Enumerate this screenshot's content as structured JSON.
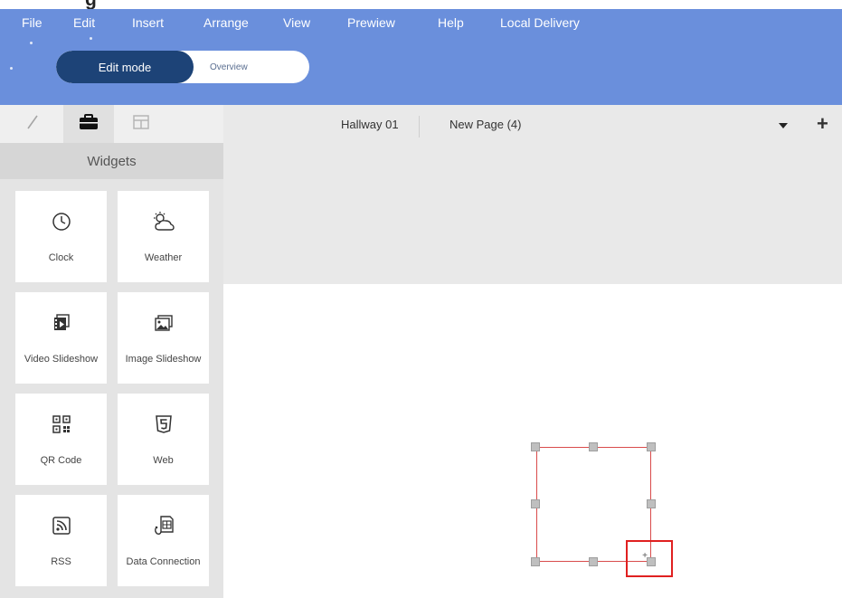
{
  "menu": {
    "items": [
      "File",
      "Edit",
      "Insert",
      "Arrange",
      "View",
      "Prewiew",
      "Help",
      "Local Delivery"
    ]
  },
  "mode": {
    "active_label": "Edit mode",
    "inactive_label": "Overview"
  },
  "sidebar": {
    "title": "Widgets",
    "tabs": [
      {
        "icon": "pencil-icon"
      },
      {
        "icon": "briefcase-icon"
      },
      {
        "icon": "layout-icon"
      }
    ],
    "widgets": [
      {
        "label": "Clock",
        "icon": "clock-icon"
      },
      {
        "label": "Weather",
        "icon": "weather-icon"
      },
      {
        "label": "Video Slideshow",
        "icon": "video-slideshow-icon"
      },
      {
        "label": "Image Slideshow",
        "icon": "image-slideshow-icon"
      },
      {
        "label": "QR Code",
        "icon": "qr-code-icon"
      },
      {
        "label": "Web",
        "icon": "html5-icon"
      },
      {
        "label": "RSS",
        "icon": "rss-icon"
      },
      {
        "label": "Data Connection",
        "icon": "data-connection-icon"
      }
    ]
  },
  "editor": {
    "page_tabs": [
      "Hallway 01",
      "New Page (4)"
    ],
    "collapse_handle": "«"
  },
  "colors": {
    "topbar": "#6a8fdc",
    "mode_active": "#1d4377",
    "frame_border": "#d94b4b",
    "highlight": "#e02020"
  }
}
